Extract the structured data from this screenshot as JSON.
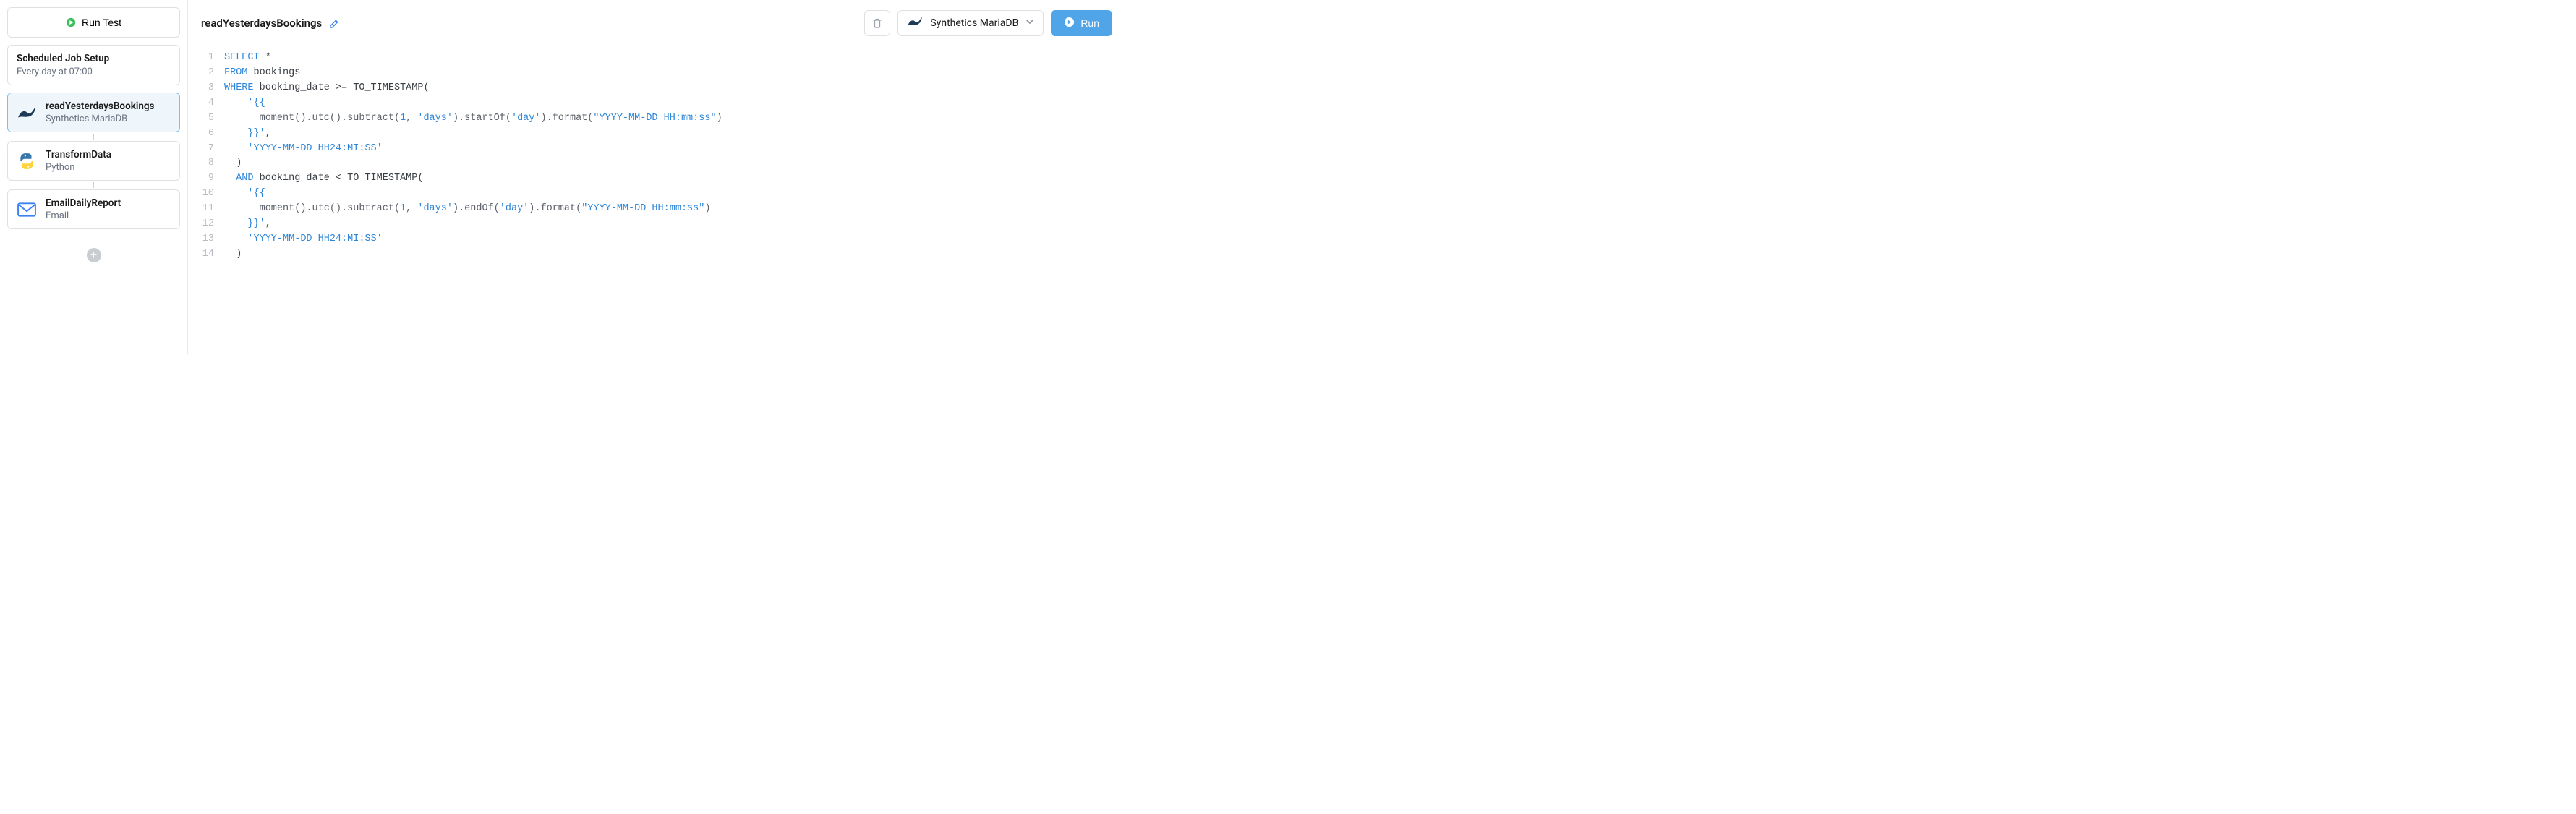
{
  "sidebar": {
    "run_test_label": "Run Test",
    "schedule": {
      "title": "Scheduled Job Setup",
      "sub": "Every day at 07:00"
    },
    "steps": [
      {
        "title": "readYesterdaysBookings",
        "sub": "Synthetics MariaDB",
        "icon": "mariadb",
        "active": true
      },
      {
        "title": "TransformData",
        "sub": "Python",
        "icon": "python",
        "active": false
      },
      {
        "title": "EmailDailyReport",
        "sub": "Email",
        "icon": "email",
        "active": false
      }
    ],
    "add_label": "+"
  },
  "topbar": {
    "title": "readYesterdaysBookings",
    "db_label": "Synthetics MariaDB",
    "run_label": "Run"
  },
  "editor": {
    "lines": [
      [
        {
          "t": "SELECT",
          "c": "kw"
        },
        {
          "t": " *",
          "c": "plain"
        }
      ],
      [
        {
          "t": "FROM",
          "c": "kw"
        },
        {
          "t": " bookings",
          "c": "plain"
        }
      ],
      [
        {
          "t": "WHERE",
          "c": "kw"
        },
        {
          "t": " booking_date >= TO_TIMESTAMP(",
          "c": "plain"
        }
      ],
      [
        {
          "t": "    ",
          "c": "plain"
        },
        {
          "t": "'{{",
          "c": "str"
        }
      ],
      [
        {
          "t": "      moment().utc().subtract(",
          "c": "func"
        },
        {
          "t": "1",
          "c": "num"
        },
        {
          "t": ", ",
          "c": "func"
        },
        {
          "t": "'days'",
          "c": "str"
        },
        {
          "t": ").startOf(",
          "c": "func"
        },
        {
          "t": "'day'",
          "c": "str"
        },
        {
          "t": ").format(",
          "c": "func"
        },
        {
          "t": "\"YYYY-MM-DD HH:mm:ss\"",
          "c": "str"
        },
        {
          "t": ")",
          "c": "func"
        }
      ],
      [
        {
          "t": "    ",
          "c": "plain"
        },
        {
          "t": "}}'",
          "c": "str"
        },
        {
          "t": ",",
          "c": "plain"
        }
      ],
      [
        {
          "t": "    ",
          "c": "plain"
        },
        {
          "t": "'YYYY-MM-DD HH24:MI:SS'",
          "c": "str"
        }
      ],
      [
        {
          "t": "  )",
          "c": "plain"
        }
      ],
      [
        {
          "t": "  ",
          "c": "plain"
        },
        {
          "t": "AND",
          "c": "kw"
        },
        {
          "t": " booking_date < TO_TIMESTAMP(",
          "c": "plain"
        }
      ],
      [
        {
          "t": "    ",
          "c": "plain"
        },
        {
          "t": "'{{",
          "c": "str"
        }
      ],
      [
        {
          "t": "      moment().utc().subtract(",
          "c": "func"
        },
        {
          "t": "1",
          "c": "num"
        },
        {
          "t": ", ",
          "c": "func"
        },
        {
          "t": "'days'",
          "c": "str"
        },
        {
          "t": ").endOf(",
          "c": "func"
        },
        {
          "t": "'day'",
          "c": "str"
        },
        {
          "t": ").format(",
          "c": "func"
        },
        {
          "t": "\"YYYY-MM-DD HH:mm:ss\"",
          "c": "str"
        },
        {
          "t": ")",
          "c": "func"
        }
      ],
      [
        {
          "t": "    ",
          "c": "plain"
        },
        {
          "t": "}}'",
          "c": "str"
        },
        {
          "t": ",",
          "c": "plain"
        }
      ],
      [
        {
          "t": "    ",
          "c": "plain"
        },
        {
          "t": "'YYYY-MM-DD HH24:MI:SS'",
          "c": "str"
        }
      ],
      [
        {
          "t": "  )",
          "c": "plain"
        }
      ]
    ]
  }
}
